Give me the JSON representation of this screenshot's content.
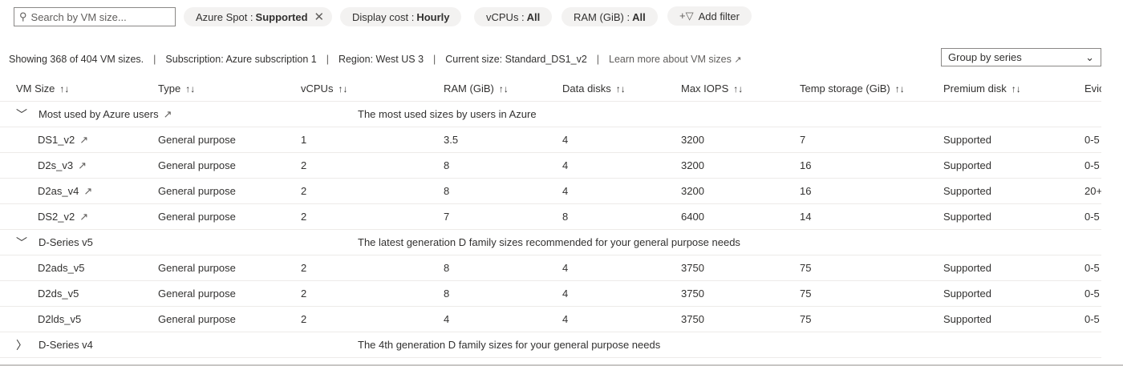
{
  "search": {
    "placeholder": "Search by VM size..."
  },
  "filters": [
    {
      "label": "Azure Spot :",
      "value": "Supported",
      "removable": true
    },
    {
      "label": "Display cost :",
      "value": "Hourly"
    },
    {
      "label": "vCPUs :",
      "value": "All"
    },
    {
      "label": "RAM (GiB) :",
      "value": "All"
    }
  ],
  "add_filter": "Add filter",
  "info": {
    "showing": "Showing 368 of 404 VM sizes.",
    "subscription": "Subscription: Azure subscription 1",
    "region": "Region: West US 3",
    "current": "Current size: Standard_DS1_v2",
    "learn_more": "Learn more about VM sizes"
  },
  "group_by": "Group by series",
  "columns": [
    "VM Size",
    "Type",
    "vCPUs",
    "RAM (GiB)",
    "Data disks",
    "Max IOPS",
    "Temp storage (GiB)",
    "Premium disk",
    "Evic"
  ],
  "groups": [
    {
      "name": "Most used by Azure users",
      "description": "The most used sizes by users in Azure",
      "expanded": true,
      "trending": true,
      "rows": [
        [
          "DS1_v2",
          "General purpose",
          "1",
          "3.5",
          "4",
          "3200",
          "7",
          "Supported",
          "0-5"
        ],
        [
          "D2s_v3",
          "General purpose",
          "2",
          "8",
          "4",
          "3200",
          "16",
          "Supported",
          "0-5"
        ],
        [
          "D2as_v4",
          "General purpose",
          "2",
          "8",
          "4",
          "3200",
          "16",
          "Supported",
          "20+"
        ],
        [
          "DS2_v2",
          "General purpose",
          "2",
          "7",
          "8",
          "6400",
          "14",
          "Supported",
          "0-5"
        ]
      ]
    },
    {
      "name": "D-Series v5",
      "description": "The latest generation D family sizes recommended for your general purpose needs",
      "expanded": true,
      "rows": [
        [
          "D2ads_v5",
          "General purpose",
          "2",
          "8",
          "4",
          "3750",
          "75",
          "Supported",
          "0-5"
        ],
        [
          "D2ds_v5",
          "General purpose",
          "2",
          "8",
          "4",
          "3750",
          "75",
          "Supported",
          "0-5"
        ],
        [
          "D2lds_v5",
          "General purpose",
          "2",
          "4",
          "4",
          "3750",
          "75",
          "Supported",
          "0-5"
        ]
      ]
    },
    {
      "name": "D-Series v4",
      "description": "The 4th generation D family sizes for your general purpose needs",
      "expanded": false,
      "rows": []
    }
  ]
}
